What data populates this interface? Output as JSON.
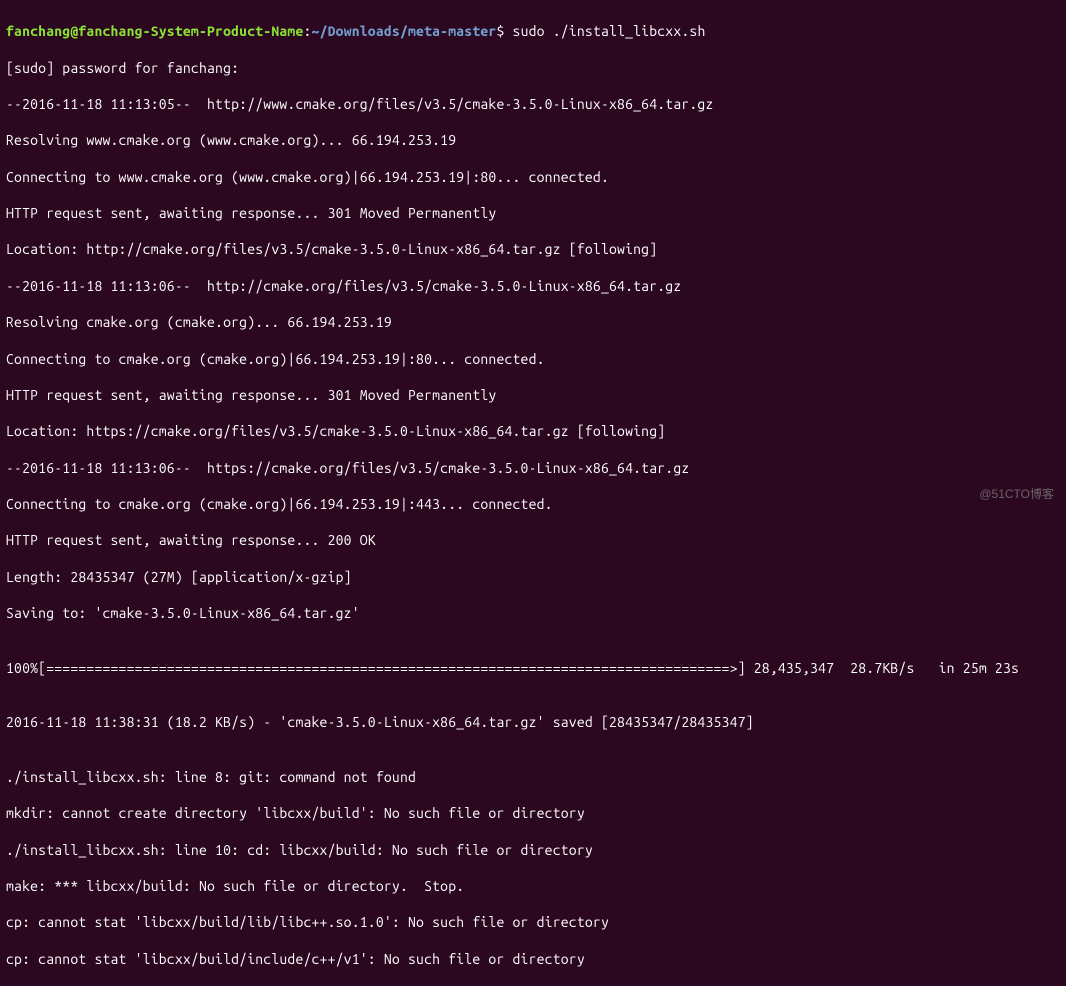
{
  "prompt": {
    "user_host": "fanchang@fanchang-System-Product-Name",
    "sep": ":",
    "path": "~/Downloads/meta-master",
    "dollar": "$",
    "command": "sudo ./install_libcxx.sh"
  },
  "lines": {
    "l1": "[sudo] password for fanchang:",
    "l2": "--2016-11-18 11:13:05--  http://www.cmake.org/files/v3.5/cmake-3.5.0-Linux-x86_64.tar.gz",
    "l3": "Resolving www.cmake.org (www.cmake.org)... 66.194.253.19",
    "l4": "Connecting to www.cmake.org (www.cmake.org)|66.194.253.19|:80... connected.",
    "l5": "HTTP request sent, awaiting response... 301 Moved Permanently",
    "l6": "Location: http://cmake.org/files/v3.5/cmake-3.5.0-Linux-x86_64.tar.gz [following]",
    "l7": "--2016-11-18 11:13:06--  http://cmake.org/files/v3.5/cmake-3.5.0-Linux-x86_64.tar.gz",
    "l8": "Resolving cmake.org (cmake.org)... 66.194.253.19",
    "l9": "Connecting to cmake.org (cmake.org)|66.194.253.19|:80... connected.",
    "l10": "HTTP request sent, awaiting response... 301 Moved Permanently",
    "l11": "Location: https://cmake.org/files/v3.5/cmake-3.5.0-Linux-x86_64.tar.gz [following]",
    "l12": "--2016-11-18 11:13:06--  https://cmake.org/files/v3.5/cmake-3.5.0-Linux-x86_64.tar.gz",
    "l13": "Connecting to cmake.org (cmake.org)|66.194.253.19|:443... connected.",
    "l14": "HTTP request sent, awaiting response... 200 OK",
    "l15": "Length: 28435347 (27M) [application/x-gzip]",
    "l16": "Saving to: 'cmake-3.5.0-Linux-x86_64.tar.gz'",
    "l17": "",
    "l18": "100%[=====================================================================================>] 28,435,347  28.7KB/s   in 25m 23s",
    "l19": "",
    "l20": "2016-11-18 11:38:31 (18.2 KB/s) - 'cmake-3.5.0-Linux-x86_64.tar.gz' saved [28435347/28435347]",
    "l21": "",
    "l22": "./install_libcxx.sh: line 8: git: command not found",
    "l23": "mkdir: cannot create directory 'libcxx/build': No such file or directory",
    "l24": "./install_libcxx.sh: line 10: cd: libcxx/build: No such file or directory",
    "l25": "make: *** libcxx/build: No such file or directory.  Stop.",
    "l26": "cp: cannot stat 'libcxx/build/lib/libc++.so.1.0': No such file or directory",
    "l27": "cp: cannot stat 'libcxx/build/include/c++/v1': No such file or directory"
  },
  "watermark": "@51CTO博客"
}
